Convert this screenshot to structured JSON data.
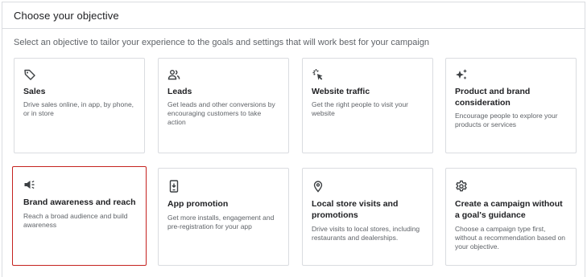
{
  "header": {
    "title": "Choose your objective"
  },
  "subtitle": "Select an objective to tailor your experience to the goals and settings that will work best for your campaign",
  "cards": [
    {
      "title": "Sales",
      "description": "Drive sales online, in app, by phone, or in store",
      "icon": "tag-icon"
    },
    {
      "title": "Leads",
      "description": "Get leads and other conversions by encouraging customers to take action",
      "icon": "people-icon"
    },
    {
      "title": "Website traffic",
      "description": "Get the right people to visit your website",
      "icon": "click-icon"
    },
    {
      "title": "Product and brand consideration",
      "description": "Encourage people to explore your products or services",
      "icon": "sparkle-icon"
    },
    {
      "title": "Brand awareness and reach",
      "description": "Reach a broad audience and build awareness",
      "icon": "megaphone-icon"
    },
    {
      "title": "App promotion",
      "description": "Get more installs, engagement and pre-registration for your app",
      "icon": "phone-icon"
    },
    {
      "title": "Local store visits and promotions",
      "description": "Drive visits to local stores, including restaurants and dealerships.",
      "icon": "location-pin-icon"
    },
    {
      "title": "Create a campaign without a goal's guidance",
      "description": "Choose a campaign type first, without a recommendation based on your objective.",
      "icon": "gear-icon"
    }
  ],
  "selected_card": "Brand awareness and reach",
  "colors": {
    "selected_border": "#c5221f",
    "border": "#dadce0",
    "title_text": "#202124",
    "secondary_text": "#5f6368"
  }
}
